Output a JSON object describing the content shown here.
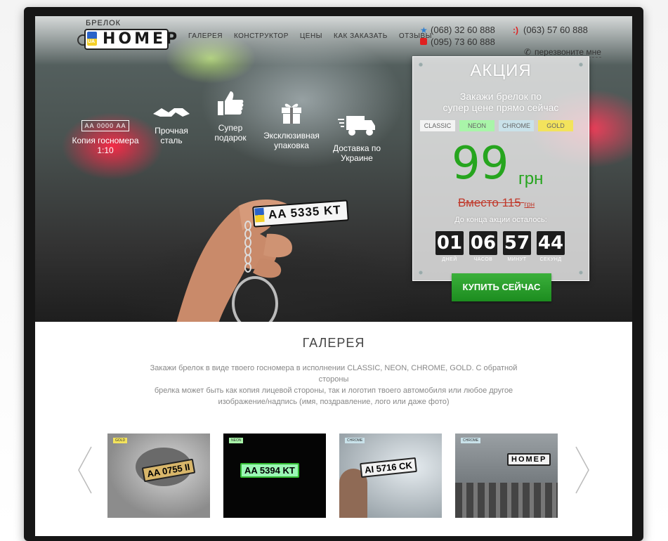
{
  "header": {
    "logo_small": "БРЕЛОК",
    "logo_main": "НОМЕР",
    "logo_flag": "UA"
  },
  "nav": [
    {
      "label": "ГАЛЕРЕЯ"
    },
    {
      "label": "КОНСТРУКТОР"
    },
    {
      "label": "ЦЕНЫ"
    },
    {
      "label": "КАК ЗАКАЗАТЬ"
    },
    {
      "label": "ОТЗЫВЫ"
    }
  ],
  "contacts": {
    "phone1": "(068) 32 60 888",
    "phone2": "(063) 57 60 888",
    "phone3": "(095) 73 60 888",
    "callback": "перезвоните мне"
  },
  "features": [
    {
      "plate": "АА 0000 АА",
      "label1": "Копия госномера",
      "label2": "1:10"
    },
    {
      "label1": "Прочная",
      "label2": "сталь"
    },
    {
      "label1": "Супер",
      "label2": "подарок"
    },
    {
      "label1": "Эксклюзивная",
      "label2": "упаковка"
    },
    {
      "label1": "Доставка по",
      "label2": "Украине"
    }
  ],
  "keychain": {
    "plate_text": "AA 5335 KT",
    "flag": "UA"
  },
  "promo": {
    "title": "АКЦИЯ",
    "subtitle_line1": "Закажи брелок по",
    "subtitle_line2": "супер цене прямо сейчас",
    "variants": [
      {
        "label": "CLASSIC",
        "color": "#f3f3f3"
      },
      {
        "label": "NEON",
        "color": "#a9f5a9"
      },
      {
        "label": "CHROME",
        "color": "#c9e2ea"
      },
      {
        "label": "GOLD",
        "color": "#f3e35c"
      }
    ],
    "price": "99",
    "currency": "грн",
    "old_price": "Вместо 115",
    "old_currency": "грн",
    "countdown_label": "До конца акции осталось:",
    "timer": [
      {
        "value": "01",
        "unit": "ДНЕЙ"
      },
      {
        "value": "06",
        "unit": "ЧАСОВ"
      },
      {
        "value": "57",
        "unit": "МИНУТ"
      },
      {
        "value": "44",
        "unit": "СЕКУНД"
      }
    ],
    "buy_label": "КУПИТЬ СЕЙЧАС"
  },
  "gallery": {
    "title": "ГАЛЕРЕЯ",
    "desc_line1": "Закажи брелок в виде твоего госномера в исполнении CLASSIC, NEON, CHROME, GOLD. С обратной стороны",
    "desc_line2": "брелка может быть как копия лицевой стороны, так и логотип твоего автомобиля или любое другое",
    "desc_line3": "изображение/надпись (имя, поздравление, лого или даже фото)",
    "items": [
      {
        "tag": "GOLD",
        "plate": "AA 0755 II"
      },
      {
        "tag": "NEON",
        "plate": "AA 5394 KT"
      },
      {
        "tag": "CHROME",
        "plate": "AI 5716 CK"
      },
      {
        "tag": "CHROME",
        "plate": "НОМЕР"
      }
    ]
  }
}
